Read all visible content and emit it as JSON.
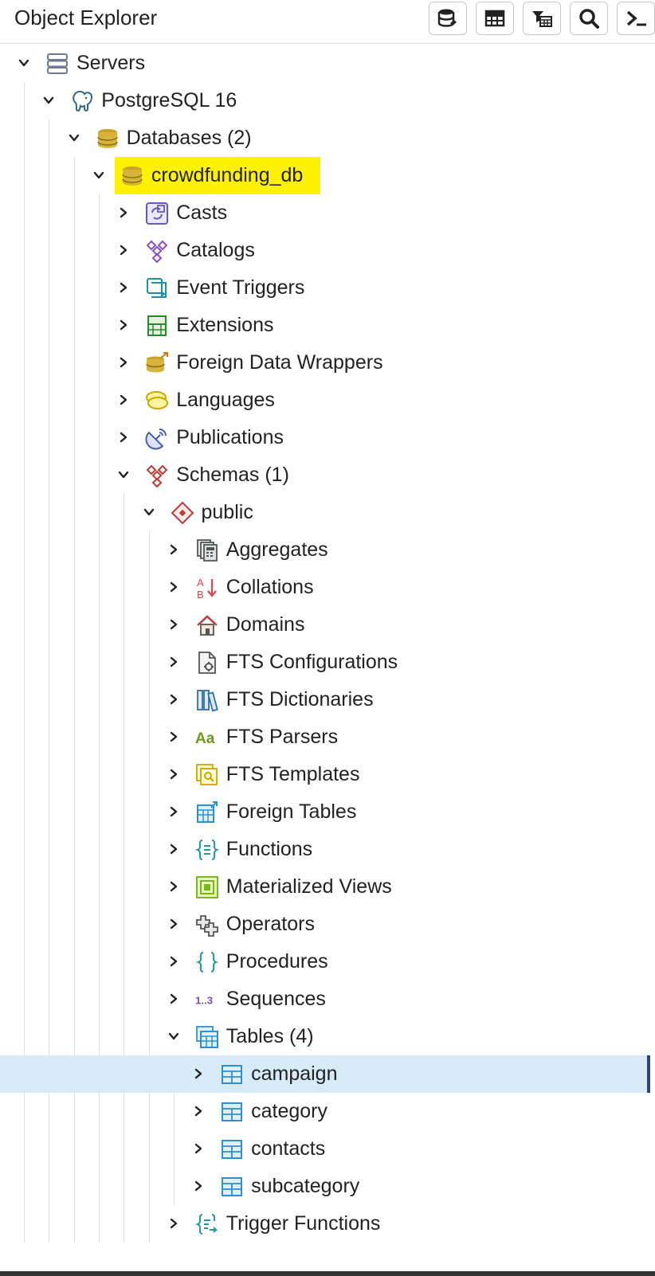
{
  "panel": {
    "title": "Object Explorer"
  },
  "toolbar": [
    {
      "name": "query-tool-button",
      "icon": "database-query-icon"
    },
    {
      "name": "view-data-button",
      "icon": "table-grid-icon"
    },
    {
      "name": "filter-rows-button",
      "icon": "filter-table-icon"
    },
    {
      "name": "search-objects-button",
      "icon": "search-icon"
    },
    {
      "name": "psql-tool-button",
      "icon": "terminal-icon"
    }
  ],
  "tree": [
    {
      "label": "Servers",
      "icon": "servers-icon",
      "level": 0,
      "expanded": true
    },
    {
      "label": "PostgreSQL 16",
      "icon": "postgresql-elephant-icon",
      "level": 1,
      "expanded": true
    },
    {
      "label": "Databases (2)",
      "icon": "databases-icon",
      "level": 2,
      "expanded": true
    },
    {
      "label": "crowdfunding_db",
      "icon": "database-icon",
      "level": 3,
      "expanded": true,
      "highlighted": true
    },
    {
      "label": "Casts",
      "icon": "casts-icon",
      "level": 4,
      "expanded": false
    },
    {
      "label": "Catalogs",
      "icon": "catalogs-icon",
      "level": 4,
      "expanded": false
    },
    {
      "label": "Event Triggers",
      "icon": "event-triggers-icon",
      "level": 4,
      "expanded": false
    },
    {
      "label": "Extensions",
      "icon": "extensions-icon",
      "level": 4,
      "expanded": false
    },
    {
      "label": "Foreign Data Wrappers",
      "icon": "foreign-data-wrappers-icon",
      "level": 4,
      "expanded": false
    },
    {
      "label": "Languages",
      "icon": "languages-icon",
      "level": 4,
      "expanded": false
    },
    {
      "label": "Publications",
      "icon": "publications-icon",
      "level": 4,
      "expanded": false
    },
    {
      "label": "Schemas (1)",
      "icon": "schemas-icon",
      "level": 4,
      "expanded": true
    },
    {
      "label": "public",
      "icon": "schema-icon",
      "level": 5,
      "expanded": true
    },
    {
      "label": "Aggregates",
      "icon": "aggregates-icon",
      "level": 6,
      "expanded": false
    },
    {
      "label": "Collations",
      "icon": "collations-icon",
      "level": 6,
      "expanded": false
    },
    {
      "label": "Domains",
      "icon": "domains-icon",
      "level": 6,
      "expanded": false
    },
    {
      "label": "FTS Configurations",
      "icon": "fts-configurations-icon",
      "level": 6,
      "expanded": false
    },
    {
      "label": "FTS Dictionaries",
      "icon": "fts-dictionaries-icon",
      "level": 6,
      "expanded": false
    },
    {
      "label": "FTS Parsers",
      "icon": "fts-parsers-icon",
      "level": 6,
      "expanded": false
    },
    {
      "label": "FTS Templates",
      "icon": "fts-templates-icon",
      "level": 6,
      "expanded": false
    },
    {
      "label": "Foreign Tables",
      "icon": "foreign-tables-icon",
      "level": 6,
      "expanded": false
    },
    {
      "label": "Functions",
      "icon": "functions-icon",
      "level": 6,
      "expanded": false
    },
    {
      "label": "Materialized Views",
      "icon": "materialized-views-icon",
      "level": 6,
      "expanded": false
    },
    {
      "label": "Operators",
      "icon": "operators-icon",
      "level": 6,
      "expanded": false
    },
    {
      "label": "Procedures",
      "icon": "procedures-icon",
      "level": 6,
      "expanded": false
    },
    {
      "label": "Sequences",
      "icon": "sequences-icon",
      "level": 6,
      "expanded": false
    },
    {
      "label": "Tables (4)",
      "icon": "tables-icon",
      "level": 6,
      "expanded": true
    },
    {
      "label": "campaign",
      "icon": "table-icon",
      "level": 7,
      "expanded": false,
      "selected": true
    },
    {
      "label": "category",
      "icon": "table-icon",
      "level": 7,
      "expanded": false
    },
    {
      "label": "contacts",
      "icon": "table-icon",
      "level": 7,
      "expanded": false
    },
    {
      "label": "subcategory",
      "icon": "table-icon",
      "level": 7,
      "expanded": false
    },
    {
      "label": "Trigger Functions",
      "icon": "trigger-functions-icon",
      "level": 6,
      "expanded": false
    }
  ],
  "colors": {
    "highlight": "#fff200",
    "selected_row": "#d6ebf7",
    "selected_marker": "#2a4a6a",
    "guide": "#dddddd"
  },
  "icon_glyphs": {
    "sequences": "1..3",
    "fts_parsers": "Aa",
    "collations_a": "A",
    "collations_b": "B",
    "collations_arrow": "↓"
  }
}
